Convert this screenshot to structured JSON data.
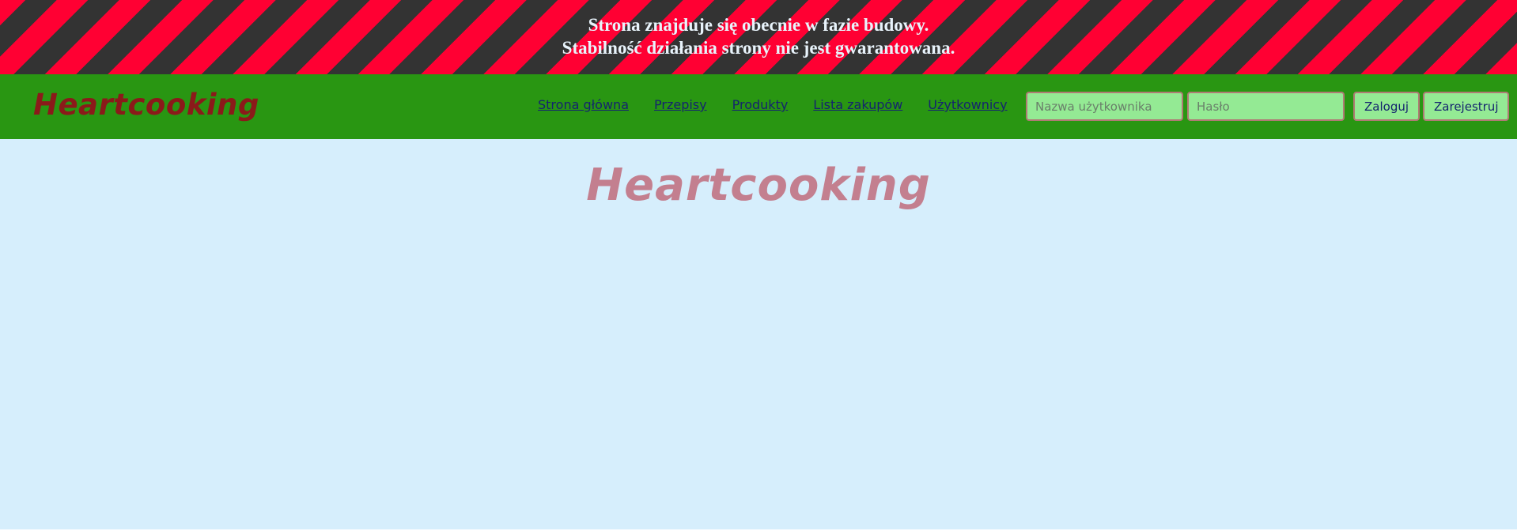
{
  "banner": {
    "line1": "Strona znajduje się obecnie w fazie budowy.",
    "line2": "Stabilność działania strony nie jest gwarantowana.",
    "stripe_colors": [
      "#ff0033",
      "#333333"
    ]
  },
  "navbar": {
    "brand": "Heartcooking",
    "background": "#299612",
    "links": [
      {
        "label": "Strona główna"
      },
      {
        "label": "Przepisy"
      },
      {
        "label": "Produkty"
      },
      {
        "label": "Lista zakupów"
      },
      {
        "label": "Użytkownicy"
      }
    ],
    "login": {
      "username_placeholder": "Nazwa użytkownika",
      "username_value": "",
      "password_placeholder": "Hasło",
      "password_value": "",
      "login_label": "Zaloguj",
      "register_label": "Zarejestruj"
    }
  },
  "main": {
    "title": "Heartcooking",
    "background": "#d6eefc"
  }
}
